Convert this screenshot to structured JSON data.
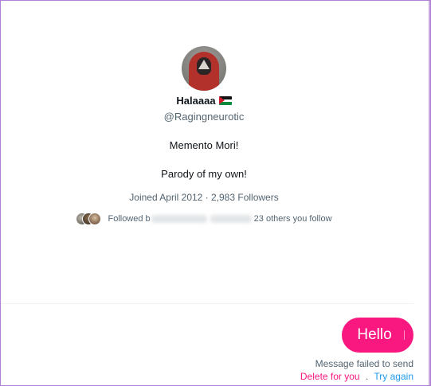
{
  "profile": {
    "display_name": "Halaaaa",
    "flag_icon": "palestine-flag-icon",
    "handle": "@Ragingneurotic",
    "bio_line1": "Memento Mori!",
    "bio_line2": "Parody of my own!",
    "joined_followers": "Joined April 2012 · 2,983 Followers",
    "followed_by_prefix": "Followed b",
    "followed_by_suffix": "23 others you follow"
  },
  "message": {
    "text": "Hello",
    "status": "Message failed to send",
    "delete_label": "Delete for you",
    "separator": ".",
    "retry_label": "Try again"
  },
  "colors": {
    "bubble": "#f91880",
    "delete_link": "#f91880",
    "retry_link": "#1d9bf0",
    "secondary_text": "#536471",
    "frame_border": "#b07fd6"
  }
}
